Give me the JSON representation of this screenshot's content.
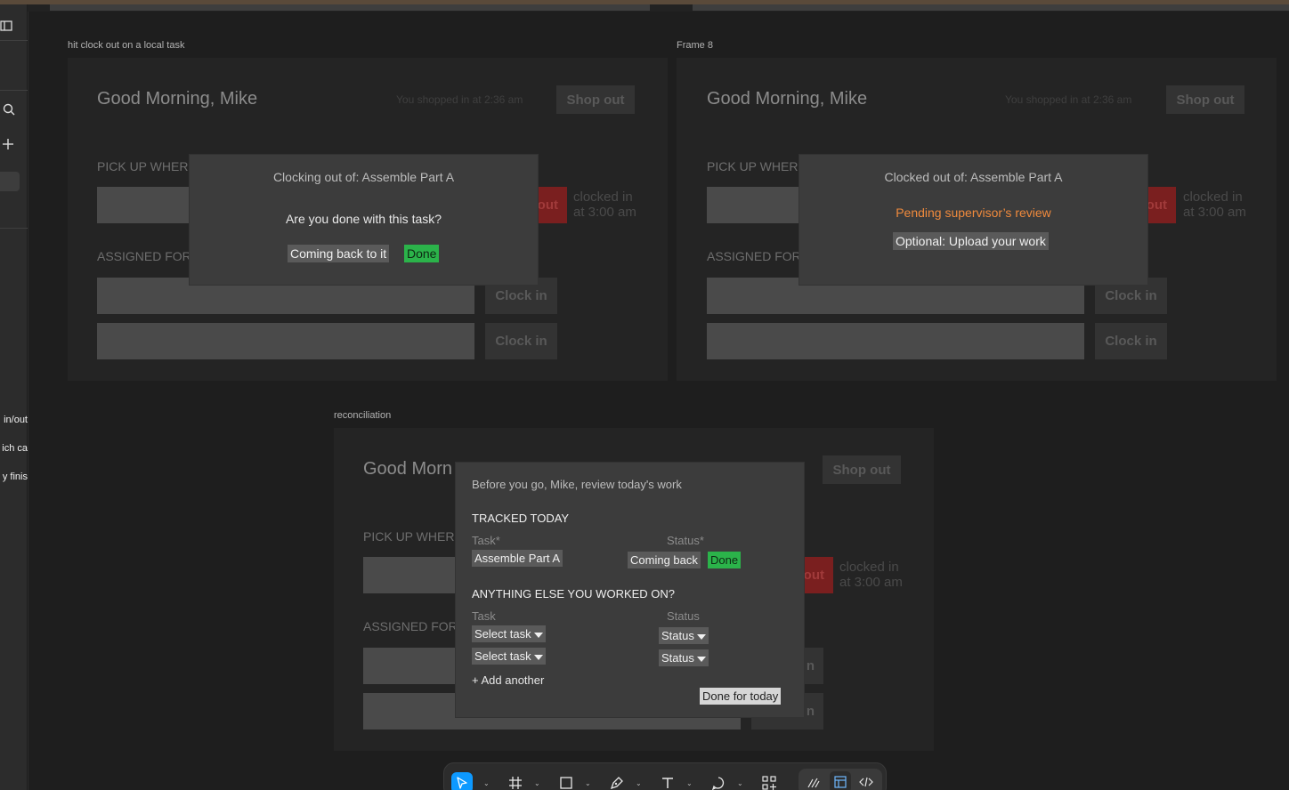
{
  "left_panel": {
    "texts": [
      "in/out",
      "ich ca",
      "y finis"
    ]
  },
  "frames": {
    "f1": {
      "label": "hit clock out on a local task",
      "greeting": "Good Morning, Mike",
      "shopped": "You shopped in at 2:36 am",
      "shop_out": "Shop out",
      "pickup": "PICK UP WHERE",
      "assigned": "ASSIGNED FOR",
      "clock_out_label": "out",
      "clocked_line1": "clocked in",
      "clocked_line2": "at 3:00 am",
      "clock_in_1": "Clock in",
      "clock_in_2": "Clock in",
      "modal": {
        "title": "Clocking out of: Assemble Part A",
        "question": "Are you done with this task?",
        "coming_back": "Coming back to it",
        "done": "Done"
      }
    },
    "f2": {
      "label": "Frame 8",
      "greeting": "Good Morning, Mike",
      "shopped": "You shopped in at 2:36 am",
      "shop_out": "Shop out",
      "pickup": "PICK UP WHERE",
      "assigned": "ASSIGNED FOR",
      "clock_out_label": "out",
      "clocked_line1": "clocked in",
      "clocked_line2": "at 3:00 am",
      "clock_in_1": "Clock in",
      "clock_in_2": "Clock in",
      "modal": {
        "title": "Clocked out of: Assemble Part A",
        "pending": "Pending supervisor’s review",
        "upload": "Optional: Upload your work"
      }
    },
    "f3": {
      "label": "reconciliation",
      "greeting": "Good Morn",
      "shop_out": "Shop out",
      "pickup": "PICK UP WHERE",
      "assigned": "ASSIGNED FOR",
      "clock_out_label": "out",
      "clocked_line1": "clocked in",
      "clocked_line2": "at 3:00 am",
      "clock_in_1": "n",
      "clock_in_2": "n",
      "modal": {
        "intro": "Before you go, Mike, review today's work",
        "tracked_heading": "TRACKED TODAY",
        "task_col": "Task*",
        "status_col": "Status*",
        "task_value": "Assemble Part A",
        "coming_back": "Coming back",
        "done": "Done",
        "else_heading": "ANYTHING ELSE YOU WORKED ON?",
        "task_col2": "Task",
        "status_col2": "Status",
        "select_task_1": "Select task",
        "select_task_2": "Select task",
        "status_dd_1": "Status",
        "status_dd_2": "Status",
        "add_another": "+ Add another",
        "done_for_today": "Done for today"
      }
    }
  },
  "toolbar": {
    "tools": [
      "move-tool",
      "frame-tool",
      "rectangle-tool",
      "pen-tool",
      "text-tool",
      "comment-tool",
      "actions-tool",
      "draw-mode",
      "design-mode",
      "dev-mode"
    ]
  },
  "colors": {
    "canvas": "#1e1e1e",
    "frame": "#242424",
    "modal": "#3c3c3c",
    "done_green": "#2bb34a",
    "pending_orange": "#f08a3c",
    "accent_blue": "#0d99ff"
  }
}
